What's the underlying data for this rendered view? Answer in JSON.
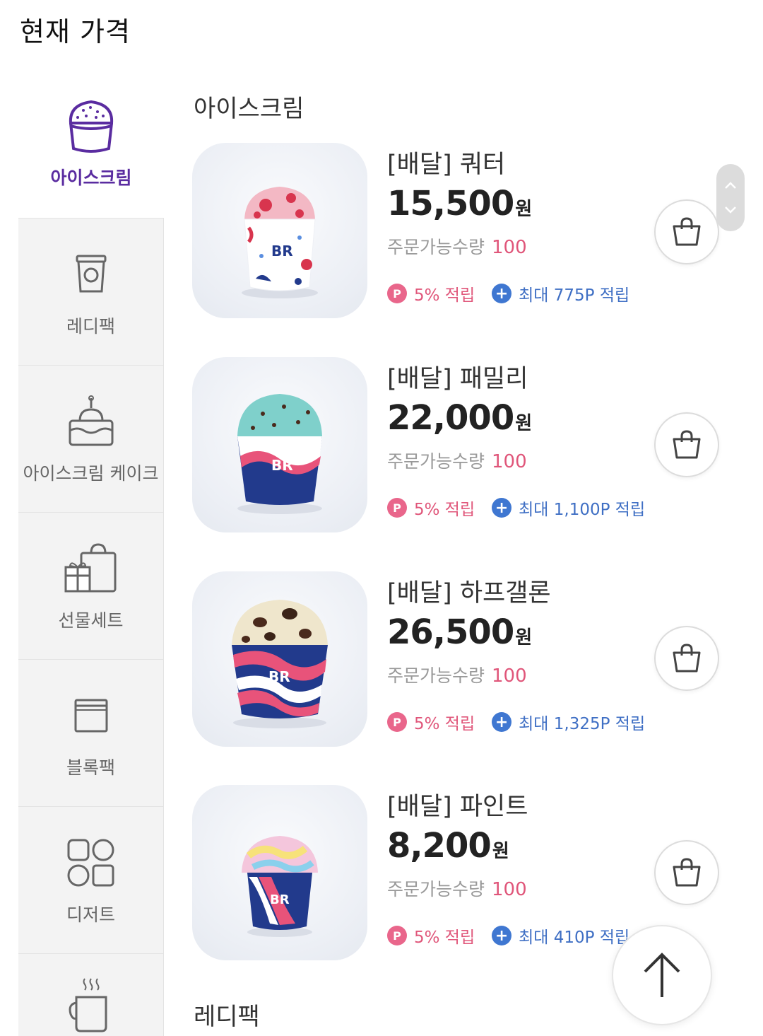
{
  "page_title": "현재 가격",
  "colors": {
    "accent": "#5a2ca0",
    "pink": "#e0567a",
    "blue": "#3f6fc4"
  },
  "sidebar": {
    "items": [
      {
        "label": "아이스크림",
        "icon": "ice-cream-cup-icon",
        "active": true
      },
      {
        "label": "레디팩",
        "icon": "ready-pack-icon",
        "active": false
      },
      {
        "label": "아이스크림 케이크",
        "icon": "cake-icon",
        "active": false
      },
      {
        "label": "선물세트",
        "icon": "gift-set-icon",
        "active": false
      },
      {
        "label": "블록팩",
        "icon": "block-pack-icon",
        "active": false
      },
      {
        "label": "디저트",
        "icon": "dessert-icon",
        "active": false
      },
      {
        "label": "",
        "icon": "coffee-cup-icon",
        "active": false
      }
    ]
  },
  "sections": [
    {
      "title": "아이스크림"
    },
    {
      "title": "레디팩"
    }
  ],
  "products": [
    {
      "name": "[배달] 쿼터",
      "price": "15,500",
      "currency": "원",
      "qty_label": "주문가능수량",
      "qty": "100",
      "points_badge": "P",
      "points_pct": "5% 적립",
      "points_max_badge": "+",
      "points_max": "최대 775P 적립",
      "image": "quarter-tub-strawberry"
    },
    {
      "name": "[배달] 패밀리",
      "price": "22,000",
      "currency": "원",
      "qty_label": "주문가능수량",
      "qty": "100",
      "points_badge": "P",
      "points_pct": "5% 적립",
      "points_max_badge": "+",
      "points_max": "최대 1,100P 적립",
      "image": "family-tub-mint"
    },
    {
      "name": "[배달] 하프갤론",
      "price": "26,500",
      "currency": "원",
      "qty_label": "주문가능수량",
      "qty": "100",
      "points_badge": "P",
      "points_pct": "5% 적립",
      "points_max_badge": "+",
      "points_max": "최대 1,325P 적립",
      "image": "half-gallon-tub-cookie"
    },
    {
      "name": "[배달] 파인트",
      "price": "8,200",
      "currency": "원",
      "qty_label": "주문가능수량",
      "qty": "100",
      "points_badge": "P",
      "points_pct": "5% 적립",
      "points_max_badge": "+",
      "points_max": "최대 410P 적립",
      "image": "pint-tub-cotton-candy"
    }
  ],
  "tub_logo": "BR"
}
